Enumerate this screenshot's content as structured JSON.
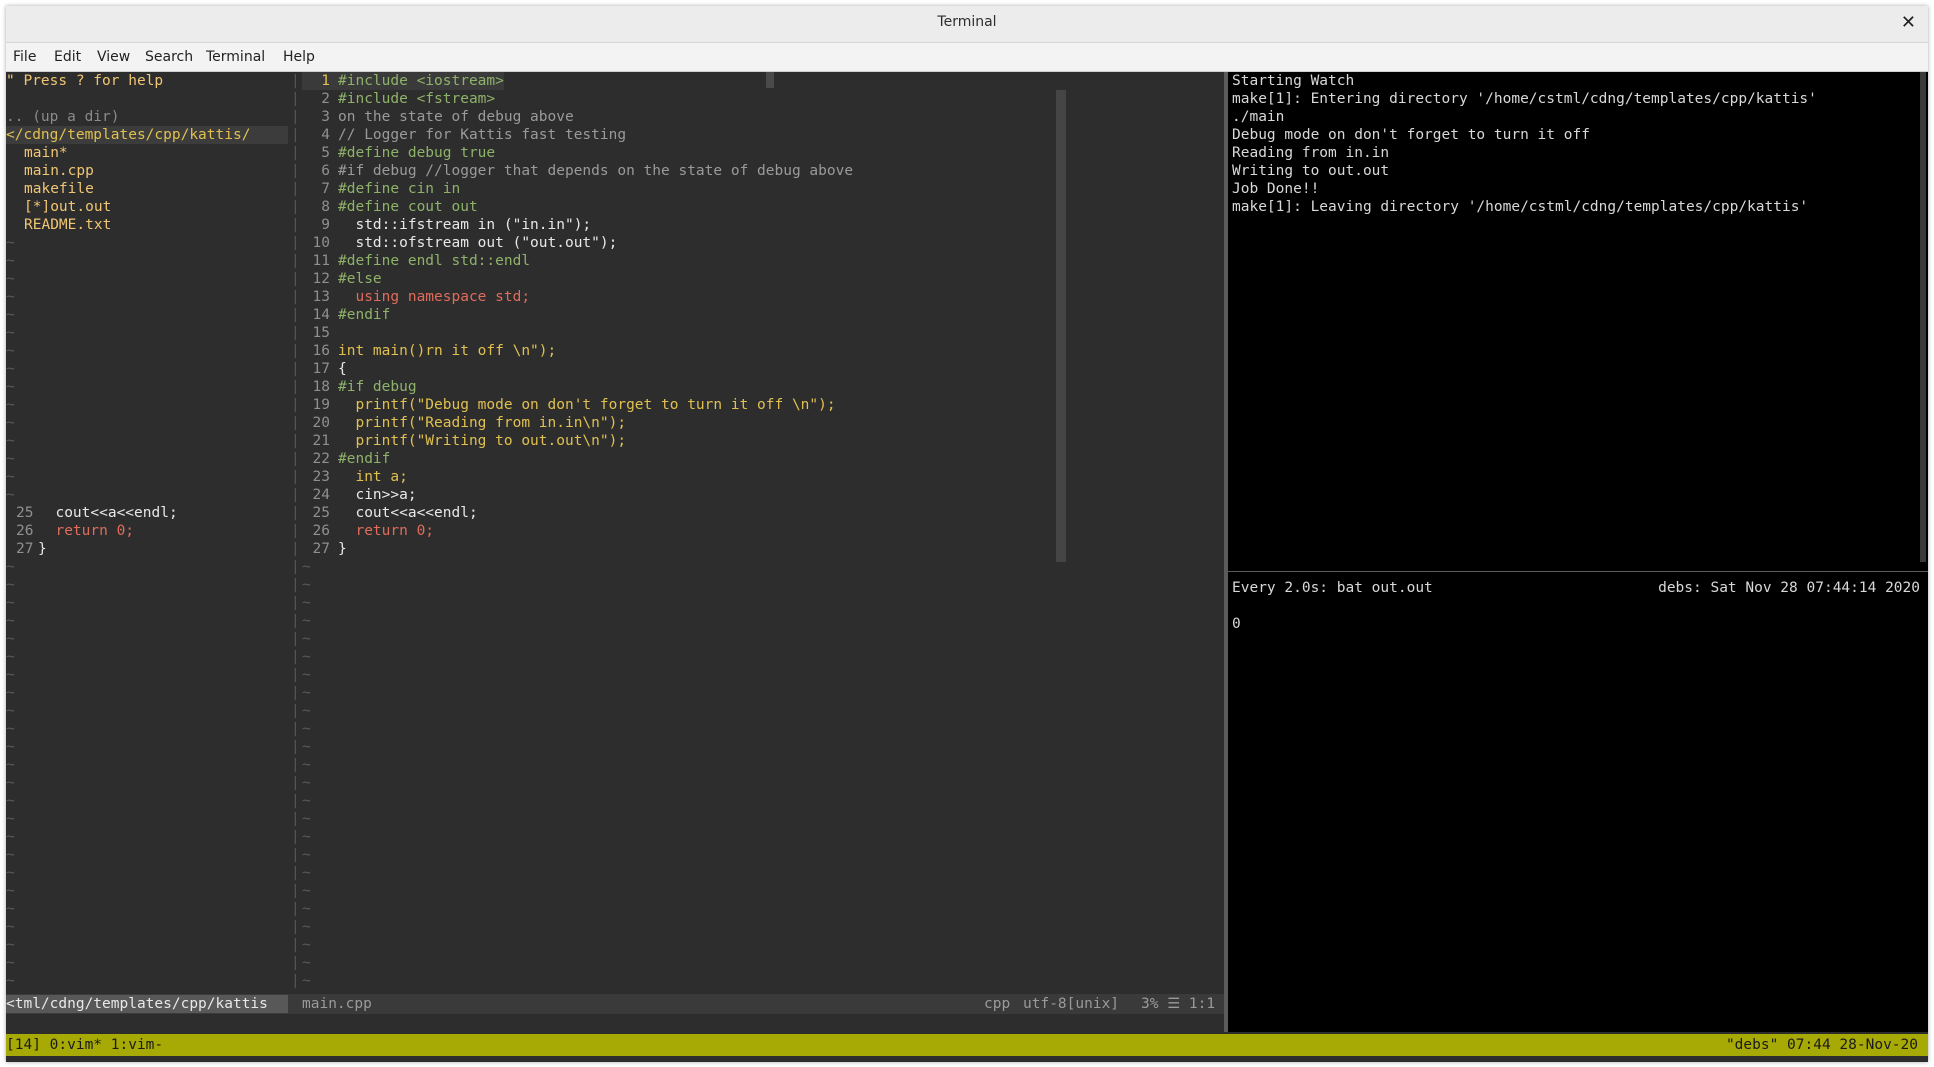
{
  "window": {
    "title": "Terminal"
  },
  "menu": [
    "File",
    "Edit",
    "View",
    "Search",
    "Terminal",
    "Help"
  ],
  "tree": {
    "help": "\" Press ? for help",
    "updir": ".. (up a dir)",
    "cwd": "</cdng/templates/cpp/kattis/",
    "files": [
      "main*",
      "main.cpp",
      "makefile",
      "[*]out.out",
      "README.txt"
    ],
    "preview_lines": [
      {
        "n": "25",
        "text": "  cout<<a<<endl;"
      },
      {
        "n": "26",
        "text": "  return 0;"
      },
      {
        "n": "27",
        "text": "}"
      }
    ]
  },
  "editor": {
    "lines": [
      {
        "n": "1",
        "text": "#include <iostream>"
      },
      {
        "n": "2",
        "text": "#include <fstream>"
      },
      {
        "n": "3",
        "text": "on the state of debug above"
      },
      {
        "n": "4",
        "text": "// Logger for Kattis fast testing"
      },
      {
        "n": "5",
        "text": "#define debug true"
      },
      {
        "n": "6",
        "text": "#if debug //logger that depends on the state of debug above"
      },
      {
        "n": "7",
        "text": "#define cin in"
      },
      {
        "n": "8",
        "text": "#define cout out"
      },
      {
        "n": "9",
        "text": "  std::ifstream in (\"in.in\");"
      },
      {
        "n": "10",
        "text": "  std::ofstream out (\"out.out\");"
      },
      {
        "n": "11",
        "text": "#define endl std::endl"
      },
      {
        "n": "12",
        "text": "#else"
      },
      {
        "n": "13",
        "text": "  using namespace std;"
      },
      {
        "n": "14",
        "text": "#endif"
      },
      {
        "n": "15",
        "text": ""
      },
      {
        "n": "16",
        "text": "int main()rn it off \\n\");"
      },
      {
        "n": "17",
        "text": "{"
      },
      {
        "n": "18",
        "text": "#if debug"
      },
      {
        "n": "19",
        "text": "  printf(\"Debug mode on don't forget to turn it off \\n\");"
      },
      {
        "n": "20",
        "text": "  printf(\"Reading from in.in\\n\");"
      },
      {
        "n": "21",
        "text": "  printf(\"Writing to out.out\\n\");"
      },
      {
        "n": "22",
        "text": "#endif"
      },
      {
        "n": "23",
        "text": "  int a;"
      },
      {
        "n": "24",
        "text": "  cin>>a;"
      },
      {
        "n": "25",
        "text": "  cout<<a<<endl;"
      },
      {
        "n": "26",
        "text": "  return 0;"
      },
      {
        "n": "27",
        "text": "}"
      }
    ]
  },
  "statusline": {
    "tree_path": "<tml/cdng/templates/cpp/kattis",
    "filename": "main.cpp",
    "filetype": "cpp",
    "encoding": "utf-8[unix]",
    "position": "3% ☰ 1:1"
  },
  "watch": {
    "log": [
      "Starting Watch",
      "make[1]: Entering directory '/home/cstml/cdng/templates/cpp/kattis'",
      "./main",
      "Debug mode on don't forget to turn it off",
      "Reading from in.in",
      "Writing to out.out",
      "Job Done!!",
      "make[1]: Leaving directory '/home/cstml/cdng/templates/cpp/kattis'"
    ],
    "header_left": "Every 2.0s: bat out.out",
    "header_right": "debs: Sat Nov 28 07:44:14 2020",
    "output": "0"
  },
  "tmux": {
    "left": "[14] 0:vim* 1:vim-",
    "right": "\"debs\" 07:44 28-Nov-20"
  },
  "colors": {
    "tmux_bar": "#a7aa05",
    "terminal_bg": "#2d2d2d",
    "watch_bg": "#000000"
  }
}
